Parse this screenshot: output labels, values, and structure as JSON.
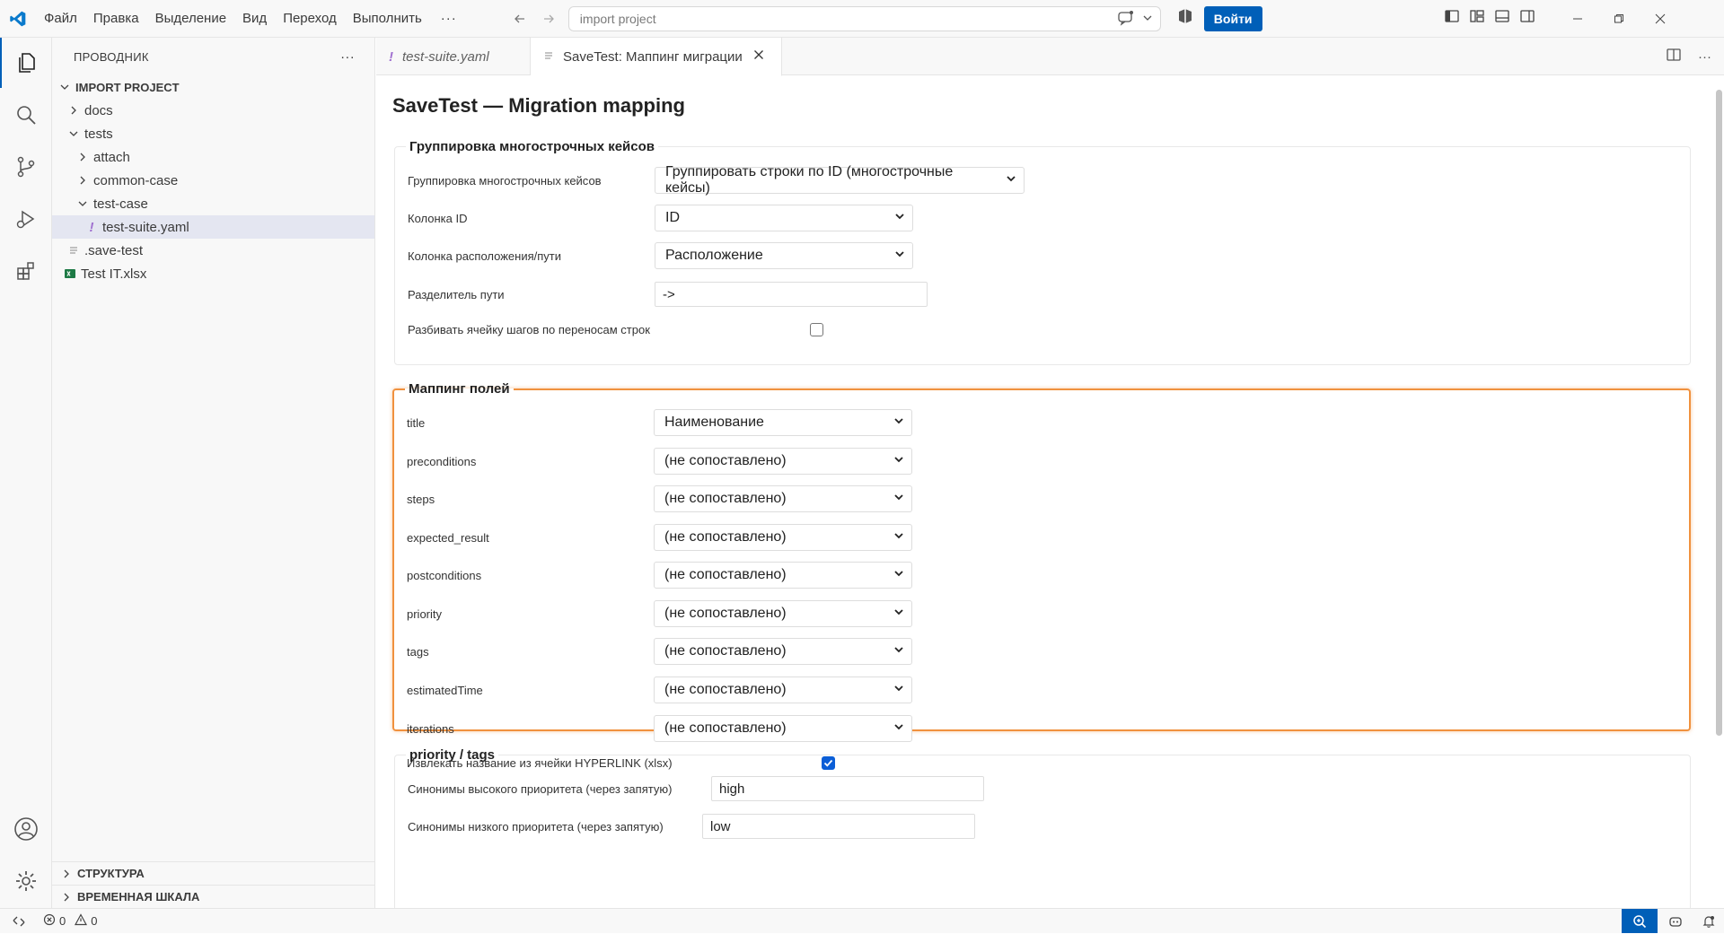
{
  "menu": {
    "items": [
      "Файл",
      "Правка",
      "Выделение",
      "Вид",
      "Переход",
      "Выполнить"
    ],
    "more": "···"
  },
  "command_center": {
    "placeholder": "import project"
  },
  "login_label": "Войти",
  "sidebar": {
    "title": "ПРОВОДНИК",
    "more": "···",
    "project": "IMPORT PROJECT",
    "tree": {
      "docs": "docs",
      "tests": "tests",
      "attach": "attach",
      "common_case": "common-case",
      "test_case": "test-case",
      "test_suite": "test-suite.yaml",
      "save_test": ".save-test",
      "test_it": "Test IT.xlsx"
    },
    "structure": "СТРУКТУРА",
    "timeline": "ВРЕМЕННАЯ ШКАЛА"
  },
  "tabs": {
    "tab1": "test-suite.yaml",
    "tab2": "SaveTest: Маппинг миграции"
  },
  "page": {
    "title": "SaveTest — Migration mapping",
    "grouping": {
      "legend": "Группировка многострочных кейсов",
      "rows": {
        "grouping_label": "Группировка многострочных кейсов",
        "grouping_value": "Группировать строки по ID (многострочные кейсы)",
        "id_label": "Колонка ID",
        "id_value": "ID",
        "path_label": "Колонка расположения/пути",
        "path_value": "Расположение",
        "sep_label": "Разделитель пути",
        "sep_value": "->",
        "split_label": "Разбивать ячейку шагов по переносам строк"
      }
    },
    "mapping": {
      "legend": "Маппинг полей",
      "title_label": "title",
      "title_value": "Наименование",
      "preconditions_label": "preconditions",
      "preconditions_value": "(не сопоставлено)",
      "steps_label": "steps",
      "steps_value": "(не сопоставлено)",
      "expected_label": "expected_result",
      "expected_value": "(не сопоставлено)",
      "post_label": "postconditions",
      "post_value": "(не сопоставлено)",
      "priority_label": "priority",
      "priority_value": "(не сопоставлено)",
      "tags_label": "tags",
      "tags_value": "(не сопоставлено)",
      "est_label": "estimatedTime",
      "est_value": "(не сопоставлено)",
      "iter_label": "iterations",
      "iter_value": "(не сопоставлено)",
      "hyperlink_label": "Извлекать название из ячейки HYPERLINK (xlsx)"
    },
    "priority": {
      "legend": "priority / tags",
      "high_label": "Синонимы высокого приоритета (через запятую)",
      "high_value": "high",
      "low_label": "Синонимы низкого приоритета (через запятую)",
      "low_value": "low"
    }
  },
  "status": {
    "errors": "0",
    "warnings": "0"
  },
  "colors": {
    "accent": "#005fb8",
    "highlight": "#f0913e",
    "yaml": "#a070d0",
    "excel": "#1d7a45"
  }
}
